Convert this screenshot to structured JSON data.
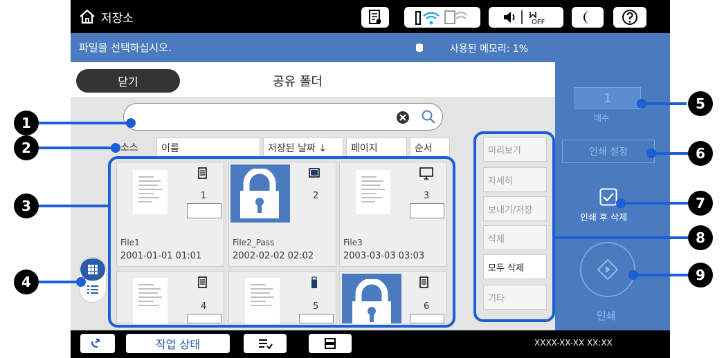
{
  "status": {
    "location": "저장소",
    "prompt": "파일을 선택하십시오.",
    "memory": "사용된 메모리: 1%"
  },
  "header": {
    "close_label": "닫기",
    "folder_title": "공유 폴더"
  },
  "columns": {
    "source": "소스",
    "name": "이름",
    "saved_date": "저장된 날짜 ↓",
    "pages": "페이지",
    "order": "순서"
  },
  "files": [
    {
      "name": "File1",
      "date": "2001-01-01 01:01",
      "index": "1"
    },
    {
      "name": "File2_Pass",
      "date": "2002-02-02 02:02",
      "index": "2"
    },
    {
      "name": "File3",
      "date": "2003-03-03 03:03",
      "index": "3"
    },
    {
      "name": "",
      "date": "",
      "index": "4"
    },
    {
      "name": "",
      "date": "",
      "index": "5"
    },
    {
      "name": "",
      "date": "",
      "index": "6"
    }
  ],
  "side_menu": {
    "preview": "미리보기",
    "details": "자세히",
    "send_save": "보내기/저장",
    "delete": "삭제",
    "delete_all": "모두 삭제",
    "other": "기타"
  },
  "print_panel": {
    "copies_value": "1",
    "copies_label": "매수",
    "print_settings": "인쇄 설정",
    "delete_after_print": "인쇄 후 삭제",
    "print_label": "인쇄"
  },
  "bottom": {
    "job_status": "작업 상태",
    "datetime": "XXXX-XX-XX XX:XX"
  },
  "callouts": [
    "1",
    "2",
    "3",
    "4",
    "5",
    "6",
    "7",
    "8",
    "9"
  ]
}
